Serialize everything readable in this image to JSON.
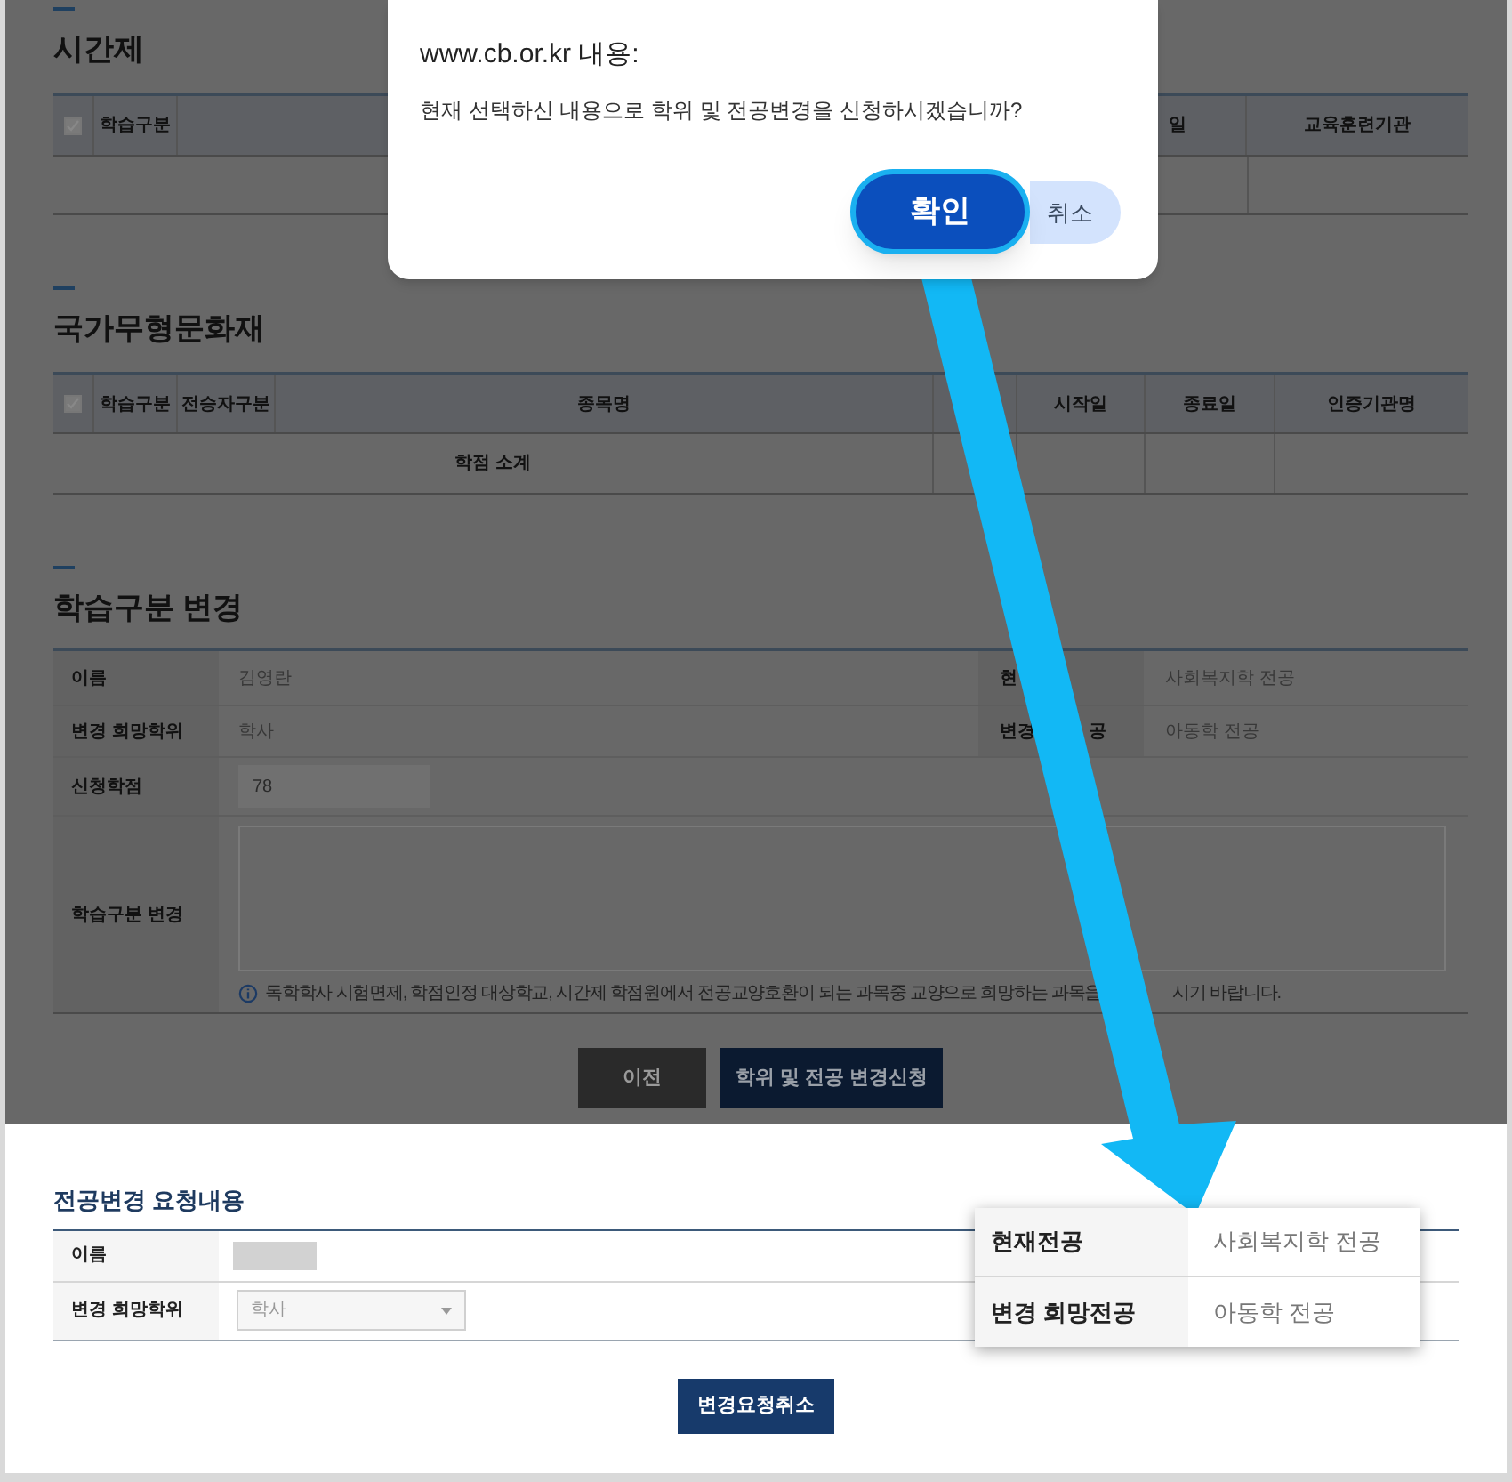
{
  "part_time": {
    "title": "시간제",
    "select_all": {
      "checked": true
    },
    "columns": [
      "학습구분",
      "일",
      "교육훈련기관"
    ]
  },
  "heritage": {
    "title": "국가무형문화재",
    "select_all": {
      "checked": true
    },
    "columns": [
      "학습구분",
      "전승자구분",
      "종목명",
      "시작일",
      "종료일",
      "인증기관명"
    ],
    "subtotal": "학점 소계"
  },
  "change_form": {
    "title": "학습구분 변경",
    "name": {
      "label": "이름",
      "value": "김영란"
    },
    "current_major": {
      "label_parts": [
        "현"
      ],
      "value": "사회복지학 전공"
    },
    "degree": {
      "label": "변경 희망학위",
      "value": "학사"
    },
    "desired_major": {
      "label_parts": [
        "변경",
        "공"
      ],
      "value": "아동학 전공"
    },
    "credits": {
      "label": "신청학점",
      "value": "78"
    },
    "change": {
      "label": "학습구분 변경"
    },
    "note_parts": [
      "독학학사 시험면제, 학점인정 대상학교, 시간제 학점원에서 전공교양호환이 되는 과목중 교양으로 희망하는 과목을",
      "시기 바랍니다."
    ],
    "buttons": [
      "이전",
      "학위 및 전공 변경신청"
    ]
  },
  "request": {
    "title": "전공변경 요청내용",
    "name_label": "이름",
    "degree_label": "변경 희망학위",
    "degree_select": "학사",
    "cancel_button": "변경요청취소"
  },
  "callout": {
    "rows": [
      {
        "label": "현재전공",
        "value": "사회복지학 전공"
      },
      {
        "label": "변경 희망전공",
        "value": "아동학 전공"
      }
    ]
  },
  "dialog": {
    "title": "www.cb.or.kr 내용:",
    "message": "현재 선택하신 내용으로 학위 및 전공변경을 신청하시겠습니까?",
    "ok": "확인",
    "cancel": "취소"
  }
}
